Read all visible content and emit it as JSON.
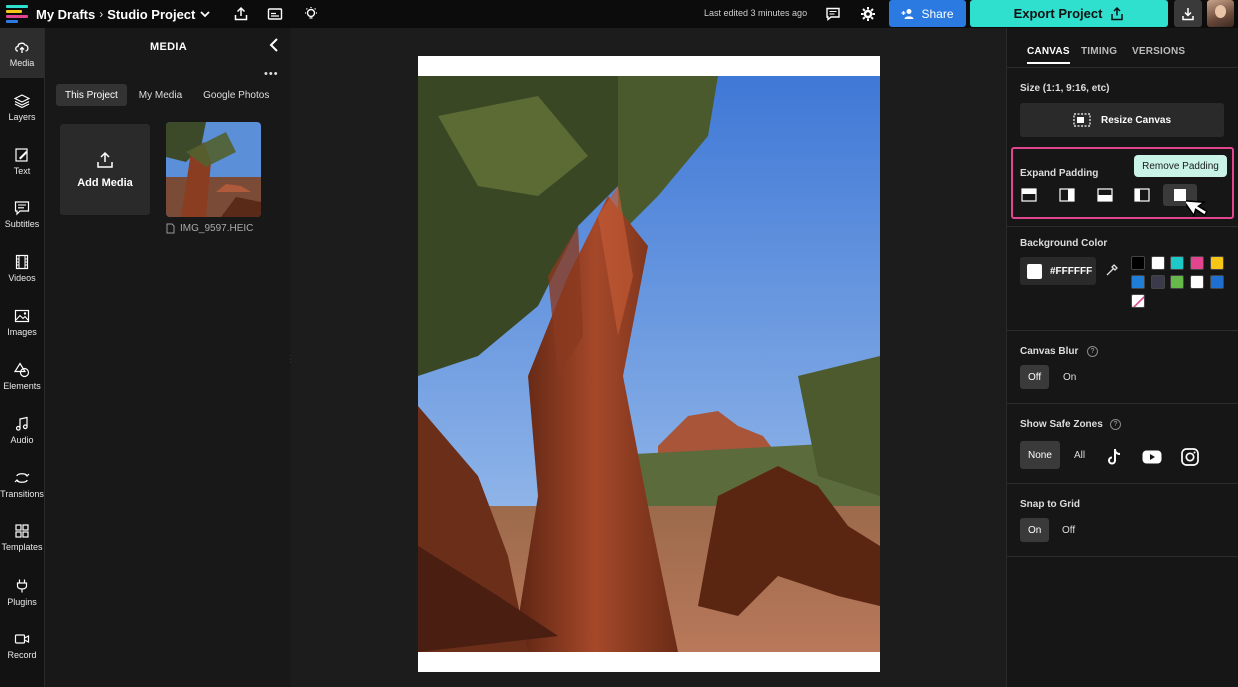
{
  "topbar": {
    "breadcrumb_root": "My Drafts",
    "breadcrumb_sep": "›",
    "project_name": "Studio Project",
    "last_edited": "Last edited 3 minutes ago",
    "share_label": "Share",
    "export_label": "Export Project",
    "accent_colors": {
      "share": "#2a7ae2",
      "export": "#2fe0cf"
    }
  },
  "rail": {
    "items": [
      {
        "label": "Media",
        "icon": "cloud-upload-icon"
      },
      {
        "label": "Layers",
        "icon": "layers-icon"
      },
      {
        "label": "Text",
        "icon": "text-edit-icon"
      },
      {
        "label": "Subtitles",
        "icon": "subtitles-icon"
      },
      {
        "label": "Videos",
        "icon": "film-icon"
      },
      {
        "label": "Images",
        "icon": "image-icon"
      },
      {
        "label": "Elements",
        "icon": "shapes-icon"
      },
      {
        "label": "Audio",
        "icon": "music-note-icon"
      },
      {
        "label": "Transitions",
        "icon": "transition-icon"
      },
      {
        "label": "Templates",
        "icon": "grid-icon"
      },
      {
        "label": "Plugins",
        "icon": "plug-icon"
      },
      {
        "label": "Record",
        "icon": "camera-icon"
      }
    ]
  },
  "media": {
    "title": "MEDIA",
    "tabs": [
      "This Project",
      "My Media",
      "Google Photos"
    ],
    "add_label": "Add Media",
    "file_name": "IMG_9597.HEIC"
  },
  "right": {
    "tabs": [
      "CANVAS",
      "TIMING",
      "VERSIONS"
    ],
    "size_label": "Size (1:1, 9:16, etc)",
    "resize_label": "Resize Canvas",
    "expand_label": "Expand Padding",
    "tooltip": "Remove Padding",
    "bg_label": "Background Color",
    "bg_value": "#FFFFFF",
    "swatches": [
      "#000000",
      "#ffffff",
      "#1ec8c8",
      "#e0458e",
      "#f5c518",
      "#1f7fd6",
      "#3a3a4a",
      "#67b84a",
      "#ffffff",
      "#1f6fd0"
    ],
    "blur_label": "Canvas Blur",
    "blur_options": [
      "Off",
      "On"
    ],
    "safe_label": "Show Safe Zones",
    "safe_options": [
      "None",
      "All"
    ],
    "snap_label": "Snap to Grid",
    "snap_options": [
      "On",
      "Off"
    ],
    "highlight_color": "#e0458e"
  }
}
